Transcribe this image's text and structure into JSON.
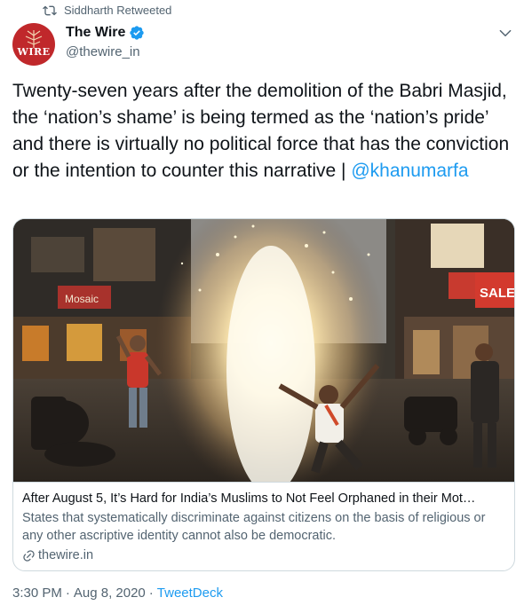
{
  "retweet": {
    "text": "Siddharth Retweeted"
  },
  "author": {
    "name": "The Wire",
    "handle": "@thewire_in",
    "avatar_text": "WIRE",
    "verified": true
  },
  "tweet": {
    "text": "Twenty-seven years after the demolition of the Babri Masjid, the ‘nation’s shame’ is being termed as the ‘nation’s pride’ and there is virtually no political force that has the conviction or the intention to counter this narrative | ",
    "mention": "@khanumarfa"
  },
  "card": {
    "image_alt": "Street celebration with fireworks at night",
    "sign_left": "Mosaic",
    "sign_right": "SALE",
    "title": "After August 5, It’s Hard for India’s Muslims to Not Feel Orphaned in their Mot…",
    "description": "States that systematically discriminate against citizens on the basis of religious or any other ascriptive identity cannot also be democratic.",
    "domain": "thewire.in"
  },
  "footer": {
    "time": "3:30 PM",
    "separator1": "·",
    "date": "Aug 8, 2020",
    "separator2": "·",
    "source": "TweetDeck"
  },
  "colors": {
    "accent": "#1d9bf0",
    "secondary_text": "#536471",
    "avatar_bg": "#c0282b"
  },
  "icons": {
    "retweet": "retweet-icon",
    "verified": "verified-badge-icon",
    "more": "chevron-down-icon",
    "link": "link-icon"
  }
}
